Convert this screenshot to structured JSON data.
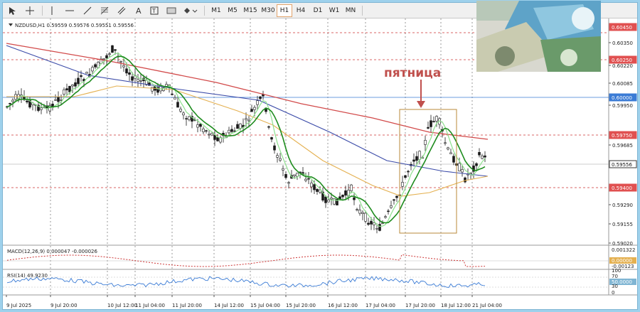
{
  "toolbar": {
    "timeframes": [
      "M1",
      "M5",
      "M15",
      "M30",
      "H1",
      "H4",
      "D1",
      "W1",
      "MN"
    ],
    "active_timeframe": "H1",
    "tool_icons": [
      "cursor-icon",
      "crosshair-icon",
      "vertical-line-icon",
      "horizontal-line-icon",
      "trendline-icon",
      "fibonacci-icon",
      "channel-icon",
      "text-icon",
      "label-icon",
      "rectangle-icon",
      "shapes-icon"
    ]
  },
  "chart": {
    "header": "NZDUSD,H1  0.59559 0.59576 0.59551 0.59556",
    "annotation": "пятница",
    "price_labels": [
      "0.60450",
      "0.60350",
      "0.60250",
      "0.60220",
      "0.60085",
      "0.60000",
      "0.59950",
      "0.59750",
      "0.59685",
      "0.59556",
      "0.59400",
      "0.59290",
      "0.59155",
      "0.59020"
    ],
    "highlighted_prices": {
      "0.60450": "#e05050",
      "0.60250": "#e05050",
      "0.60000": "#3a7bd5",
      "0.59750": "#e05050",
      "0.59556": "#ffffff",
      "0.59400": "#e05050"
    },
    "macd_header": "MACD(12,26,9) 0.000047 -0.000026",
    "macd_labels": [
      "0.001322",
      "0.00000",
      "-0.00123"
    ],
    "rsi_header": "RSI(14) 49.9230",
    "rsi_labels": [
      "100",
      "70",
      "50.0000",
      "30",
      "0"
    ],
    "x_labels": [
      "9 Jul 2025",
      "9 Jul 20:00",
      "10 Jul 12:00",
      "11 Jul 04:00",
      "11 Jul 20:00",
      "14 Jul 12:00",
      "15 Jul 04:00",
      "15 Jul 20:00",
      "16 Jul 12:00",
      "17 Jul 04:00",
      "17 Jul 20:00",
      "18 Jul 12:00",
      "21 Jul 04:00"
    ]
  },
  "colors": {
    "bull": "#1a1a1a",
    "ma_red": "#d24a4a",
    "ma_blue": "#3a4aa8",
    "ma_orange": "#e4b050",
    "ma_green_dark": "#1e8c1e",
    "ma_green_light": "#8ee08e",
    "rect": "#b98a3a",
    "annotation": "#c0504d"
  }
}
